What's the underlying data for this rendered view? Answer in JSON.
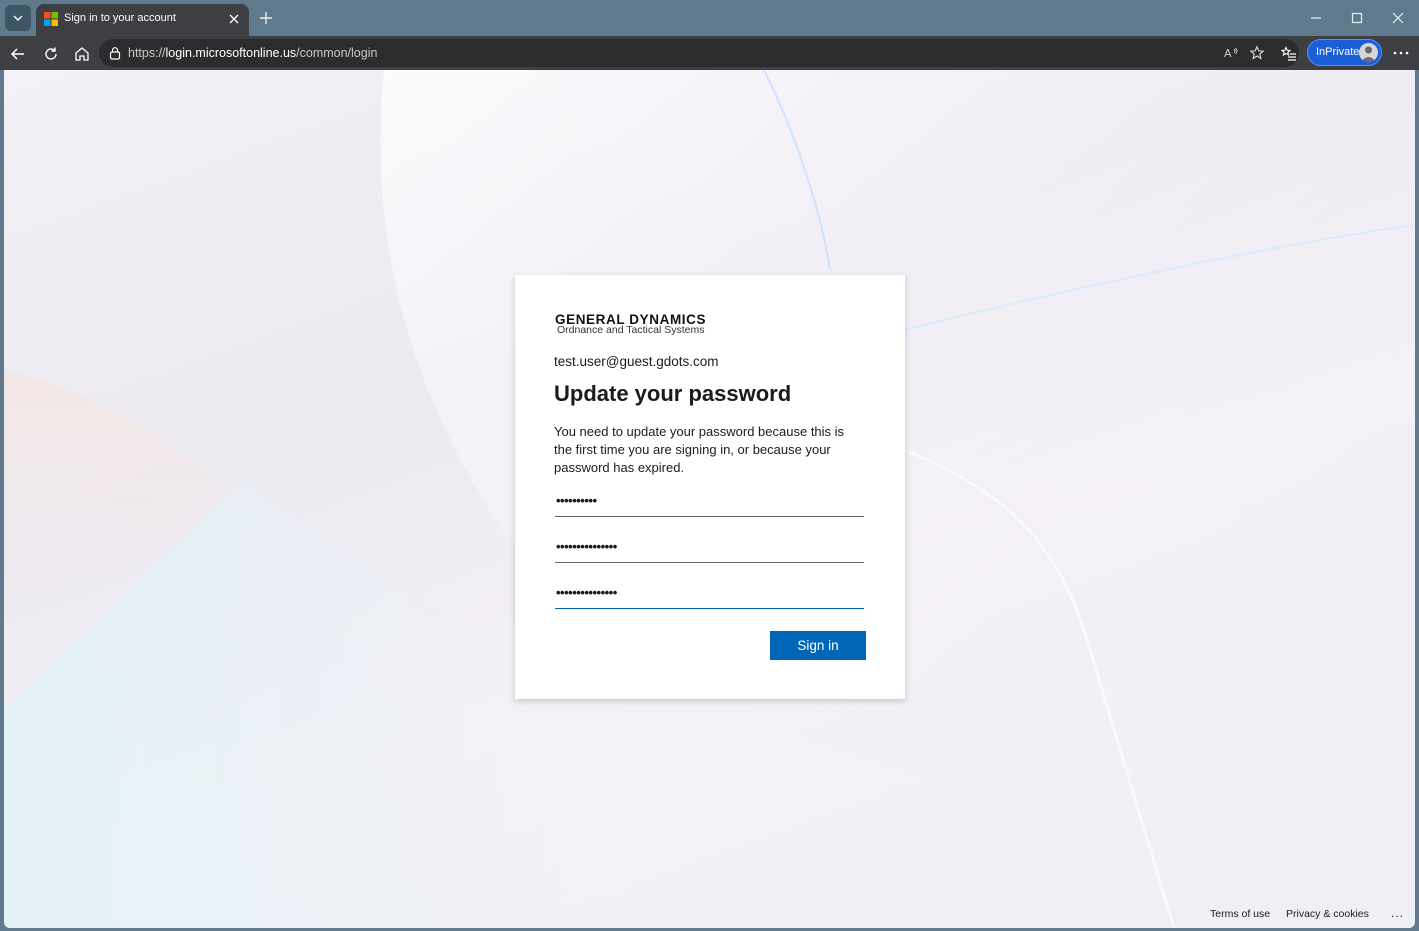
{
  "browser": {
    "tab_title": "Sign in to your account",
    "url_prefix": "https://",
    "url_host": "login.microsoftonline.us",
    "url_path": "/common/login",
    "inprivate_label": "InPrivate"
  },
  "signin_page": {
    "brand": "GENERAL DYNAMICS",
    "division": "Ordnance and Tactical Systems",
    "identity": "test.user@guest.gdots.com",
    "title": "Update your password",
    "description": "You need to update your password because this is the first time you are signing in, or because your password has expired.",
    "fields": [
      {
        "masked_value": "••••••••••"
      },
      {
        "masked_value": "•••••••••••••••"
      },
      {
        "masked_value": "•••••••••••••••"
      }
    ],
    "signin_label": "Sign in"
  },
  "footer": {
    "terms": "Terms of use",
    "privacy": "Privacy & cookies",
    "more": "..."
  },
  "colors": {
    "accent": "#0067b8",
    "inprivate": "#1a5fd6",
    "chrome_dark": "#3d3f42",
    "titlebar": "#5f7a8c"
  }
}
